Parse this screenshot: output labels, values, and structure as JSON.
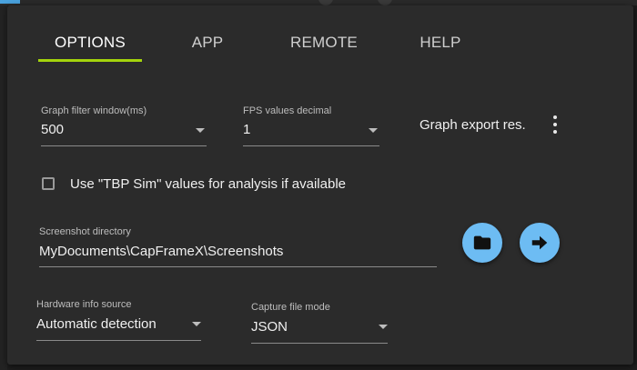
{
  "tabs": [
    {
      "label": "OPTIONS",
      "active": true
    },
    {
      "label": "APP",
      "active": false
    },
    {
      "label": "REMOTE",
      "active": false
    },
    {
      "label": "HELP",
      "active": false
    }
  ],
  "colors": {
    "accent_underline": "#a4d40c",
    "button_fill": "#6dbcf3",
    "dialog_bg": "#2b2b2b"
  },
  "graph_filter": {
    "label": "Graph filter window(ms)",
    "value": "500"
  },
  "fps_decimal": {
    "label": "FPS values decimal",
    "value": "1"
  },
  "graph_export": {
    "label": "Graph export res.",
    "icon": "more-vertical-icon"
  },
  "tbp_checkbox": {
    "label": "Use \"TBP Sim\" values for analysis if available",
    "checked": false
  },
  "screenshot_dir": {
    "label": "Screenshot directory",
    "value": "MyDocuments\\CapFrameX\\Screenshots",
    "browse_icon": "folder-icon",
    "open_icon": "arrow-right-icon"
  },
  "hardware_source": {
    "label": "Hardware info source",
    "value": "Automatic detection"
  },
  "capture_mode": {
    "label": "Capture file mode",
    "value": "JSON"
  }
}
